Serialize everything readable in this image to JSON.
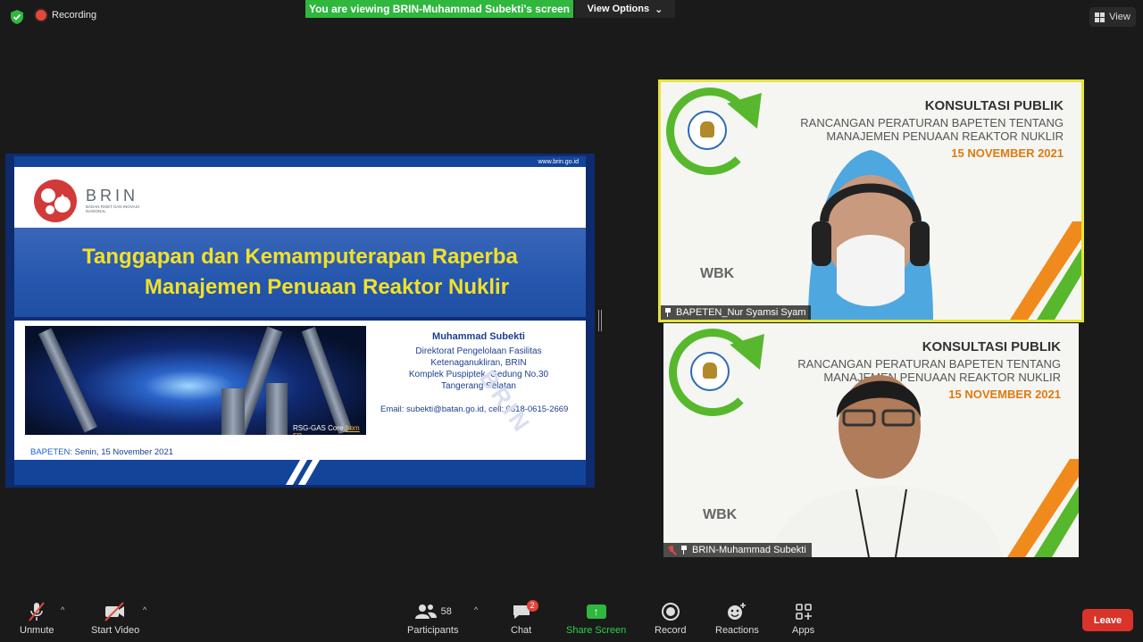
{
  "topbar": {
    "recording_label": "Recording",
    "viewing_banner": "You are viewing BRIN-Muhammad Subekti's screen",
    "view_options": "View Options",
    "view_button": "View"
  },
  "slide": {
    "url": "www.brin.go.id",
    "logo_text": "BRIN",
    "logo_subtitle": "BADAN RISET DAN INOVASI NASIONAL",
    "title_line1": "Tanggapan dan Kemamputerapan Raperba",
    "title_line2": "Manajemen Penuaan Reaktor Nuklir",
    "image_caption": "RSG-GAS Core",
    "image_caption_link": "from FB",
    "speaker_name": "Muhammad Subekti",
    "speaker_line1": "Direktorat Pengelolaan Fasilitas",
    "speaker_line2": "Ketenaganukliran, BRIN",
    "speaker_line3": "Komplek Puspiptek, Gedung No.30",
    "speaker_line4": "Tangerang Selatan",
    "email_line": "Email: subekti@batan.go.id, cell: 0818-0615-2669",
    "footer_org": "BAPETEN",
    "footer_date": ": Senin, 15 November 2021",
    "watermark": "BRIN"
  },
  "tiles": [
    {
      "background_title": "KONSULTASI PUBLIK",
      "background_sub1": "RANCANGAN PERATURAN BAPETEN TENTANG",
      "background_sub2": "MANAJEMEN PENUAAN REAKTOR NUKLIR",
      "background_date": "15 NOVEMBER 2021",
      "participant_name": "BAPETEN_Nur Syamsi Syam",
      "active_speaker": true,
      "muted": false
    },
    {
      "background_title": "KONSULTASI PUBLIK",
      "background_sub1": "RANCANGAN PERATURAN BAPETEN TENTANG",
      "background_sub2": "MANAJEMEN PENUAAN REAKTOR NUKLIR",
      "background_date": "15 NOVEMBER 2021",
      "participant_name": "BRIN-Muhammad Subekti",
      "active_speaker": false,
      "muted": true
    }
  ],
  "toolbar": {
    "unmute": "Unmute",
    "start_video": "Start Video",
    "participants": "Participants",
    "participants_count": "58",
    "chat": "Chat",
    "chat_badge": "2",
    "share_screen": "Share Screen",
    "record": "Record",
    "reactions": "Reactions",
    "apps": "Apps",
    "leave": "Leave"
  },
  "colors": {
    "banner_green": "#2fb73e",
    "leave_red": "#d9332a",
    "active_speaker_outline": "#e6e33a",
    "slide_title_yellow": "#f2e02a",
    "slide_blue": "#12449a"
  }
}
